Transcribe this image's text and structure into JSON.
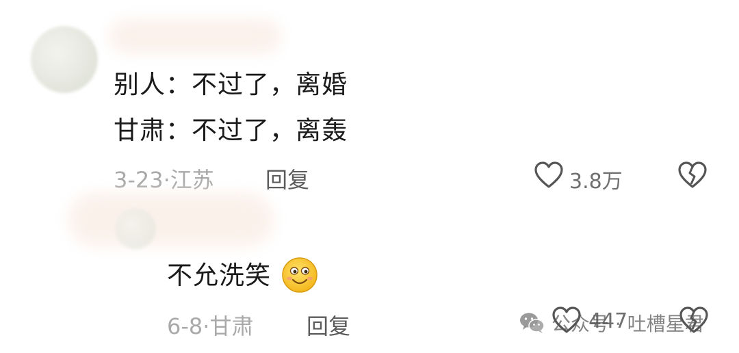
{
  "comments": [
    {
      "lines": [
        "别人：不过了，离婚",
        "甘肃：不过了，离轰"
      ],
      "date": "3-23",
      "location": "江苏",
      "reply_label": "回复",
      "likes": "3.8万"
    },
    {
      "text": "不允洗笑",
      "emoji": "smile-emoji",
      "date": "6-8",
      "location": "甘肃",
      "reply_label": "回复",
      "likes": "447"
    }
  ],
  "watermark": {
    "text": "公众号 · 吐槽星君",
    "icon": "wechat-icon"
  },
  "colors": {
    "meta": "#a9a9a9",
    "reply": "#5b5b5b",
    "icon": "#555555"
  }
}
